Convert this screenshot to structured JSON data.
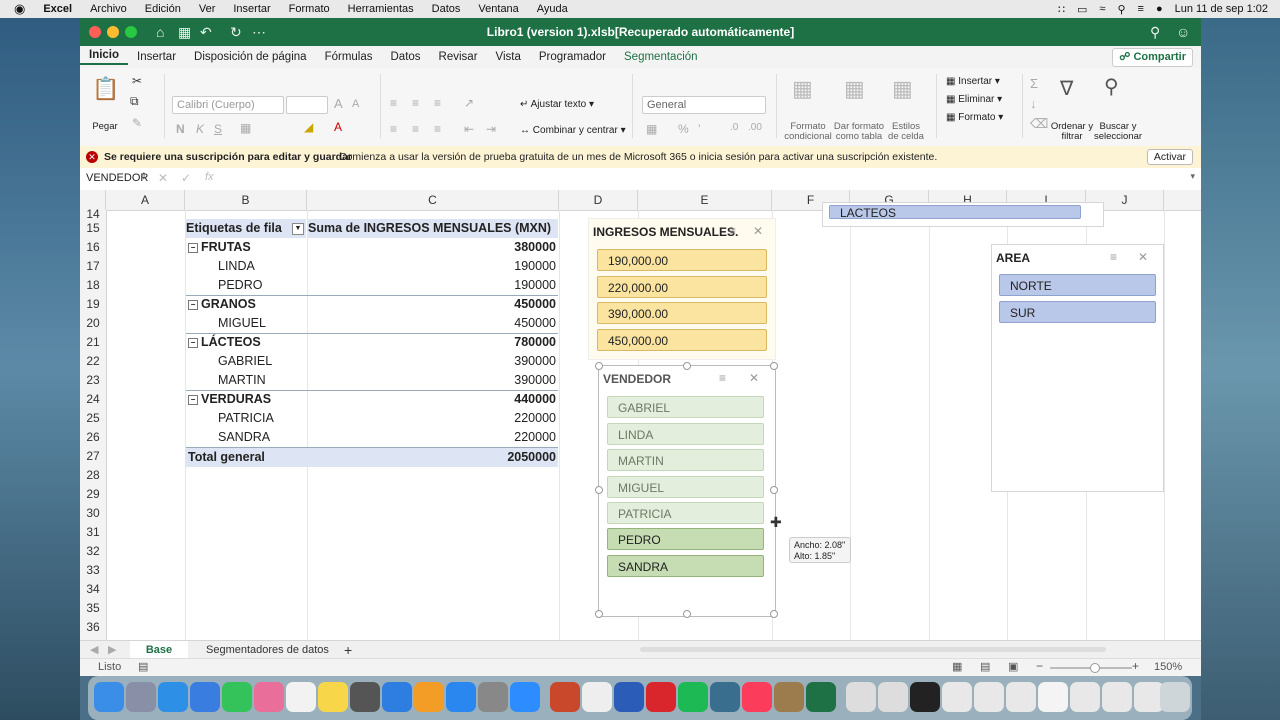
{
  "menubar": {
    "apple": "",
    "items": [
      "Excel",
      "Archivo",
      "Edición",
      "Ver",
      "Insertar",
      "Formato",
      "Herramientas",
      "Datos",
      "Ventana",
      "Ayuda"
    ],
    "datetime": "Lun 11 de sep  1:02"
  },
  "window": {
    "title": "Libro1 (version 1).xlsb[Recuperado automáticamente]"
  },
  "ribbon": {
    "tabs": [
      "Inicio",
      "Insertar",
      "Disposición de página",
      "Fórmulas",
      "Datos",
      "Revisar",
      "Vista",
      "Programador",
      "Segmentación"
    ],
    "share": "Compartir",
    "paste": "Pegar",
    "font_name": "Calibri (Cuerpo)",
    "wrap_text": "Ajustar texto",
    "merge_center": "Combinar y centrar",
    "number_format": "General",
    "cond_format": "Formato condicional",
    "format_table": "Dar formato como tabla",
    "cell_styles": "Estilos de celda",
    "insert": "Insertar",
    "delete": "Eliminar",
    "format": "Formato",
    "sort_filter": "Ordenar y filtrar",
    "find_select": "Buscar y seleccionar"
  },
  "infobar": {
    "bold": "Se requiere una suscripción para editar y guardar",
    "text": "Comienza a usar la versión de prueba gratuita de un mes de Microsoft 365 o inicia sesión para activar una suscripción existente.",
    "button": "Activar"
  },
  "formulabar": {
    "namebox": "VENDEDOR",
    "fx": "fx"
  },
  "grid": {
    "columns": [
      "A",
      "B",
      "C",
      "D",
      "E",
      "F",
      "G",
      "H",
      "I",
      "J"
    ],
    "rows": [
      "14",
      "15",
      "16",
      "17",
      "18",
      "19",
      "20",
      "21",
      "22",
      "23",
      "24",
      "25",
      "26",
      "27",
      "28",
      "29",
      "30",
      "31",
      "32",
      "33",
      "34",
      "35",
      "36"
    ],
    "pivot_header_label": "Etiquetas de fila",
    "pivot_header_value": "Suma de INGRESOS MENSUALES (MXN)",
    "pivot_rows": [
      {
        "label": "FRUTAS",
        "value": "380000",
        "level": 0
      },
      {
        "label": "LINDA",
        "value": "190000",
        "level": 1
      },
      {
        "label": "PEDRO",
        "value": "190000",
        "level": 1
      },
      {
        "label": "GRANOS",
        "value": "450000",
        "level": 0
      },
      {
        "label": "MIGUEL",
        "value": "450000",
        "level": 1
      },
      {
        "label": "LÁCTEOS",
        "value": "780000",
        "level": 0
      },
      {
        "label": "GABRIEL",
        "value": "390000",
        "level": 1
      },
      {
        "label": "MARTIN",
        "value": "390000",
        "level": 1
      },
      {
        "label": "VERDURAS",
        "value": "440000",
        "level": 0
      },
      {
        "label": "PATRICIA",
        "value": "220000",
        "level": 1
      },
      {
        "label": "SANDRA",
        "value": "220000",
        "level": 1
      }
    ],
    "total_label": "Total general",
    "total_value": "2050000"
  },
  "slicers": {
    "lacteos_partial": "LACTEOS",
    "ingresos": {
      "title": "INGRESOS MENSUALES...",
      "items": [
        "190,000.00",
        "220,000.00",
        "390,000.00",
        "450,000.00"
      ]
    },
    "area": {
      "title": "AREA",
      "items": [
        "NORTE",
        "SUR"
      ]
    },
    "vendedor": {
      "title": "VENDEDOR",
      "items": [
        {
          "label": "GABRIEL",
          "selected": false
        },
        {
          "label": "LINDA",
          "selected": false
        },
        {
          "label": "MARTIN",
          "selected": false
        },
        {
          "label": "MIGUEL",
          "selected": false
        },
        {
          "label": "PATRICIA",
          "selected": false
        },
        {
          "label": "PEDRO",
          "selected": true
        },
        {
          "label": "SANDRA",
          "selected": true
        }
      ]
    },
    "size_tooltip": {
      "width": "Ancho: 2.08\"",
      "height": "Alto: 1.85\""
    }
  },
  "sheets": {
    "tabs": [
      "Base",
      "Segmentadores de datos"
    ],
    "active": "Base",
    "add": "+"
  },
  "status": {
    "ready": "Listo",
    "zoom": "150%"
  },
  "colors": {
    "excel_green": "#1e7145",
    "slicer_yellow": "#fbe4a0",
    "slicer_blue": "#b9c8e8",
    "slicer_green": "#c6dcb3"
  }
}
